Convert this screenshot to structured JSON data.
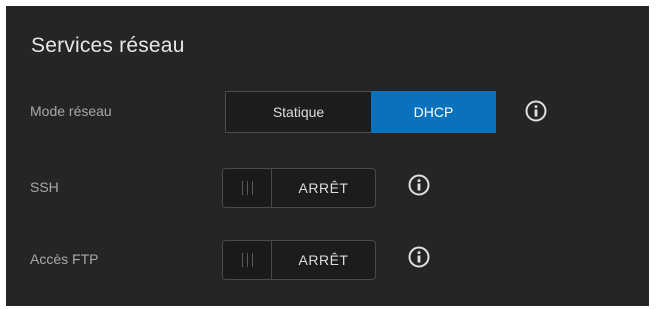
{
  "section": {
    "title": "Services réseau"
  },
  "network_mode": {
    "label": "Mode réseau",
    "options": [
      "Statique",
      "DHCP"
    ],
    "selected": "DHCP"
  },
  "ssh": {
    "label": "SSH",
    "state": "ARRÊT"
  },
  "ftp": {
    "label": "Accès FTP",
    "state": "ARRÊT"
  },
  "icons": {
    "info": "info-circle-icon"
  },
  "colors": {
    "panel_bg": "#252525",
    "accent_selected": "#0a72bd",
    "label_text": "#a8a8a8"
  }
}
